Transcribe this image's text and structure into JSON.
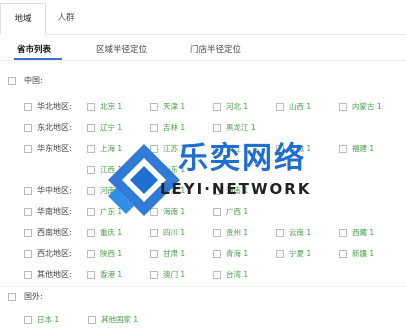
{
  "tabs": [
    {
      "label": "地域",
      "active": true
    },
    {
      "label": "人群",
      "active": false
    }
  ],
  "sub_tabs": [
    {
      "label": "省市列表",
      "active": true
    },
    {
      "label": "区域半径定位",
      "active": false
    },
    {
      "label": "门店半径定位",
      "active": false
    }
  ],
  "china": {
    "label": "中国:",
    "regions": [
      {
        "label": "华北地区:",
        "cities": [
          "北京 1",
          "天津 1",
          "河北 1",
          "山西 1",
          "内蒙古 1"
        ]
      },
      {
        "label": "东北地区:",
        "cities": [
          "辽宁 1",
          "吉林 1",
          "黑龙江 1"
        ]
      },
      {
        "label": "华东地区:",
        "cities": [
          "上海 1",
          "江苏 1",
          "浙江 1",
          "安徽 1",
          "福建 1",
          "江西 1",
          "山东 1"
        ]
      },
      {
        "label": "华中地区:",
        "cities": [
          "河南 1",
          "湖北 1",
          "湖南 1"
        ]
      },
      {
        "label": "华南地区:",
        "cities": [
          "广东 1",
          "海南 1",
          "广西 1"
        ]
      },
      {
        "label": "西南地区:",
        "cities": [
          "重庆 1",
          "四川 1",
          "贵州 1",
          "云南 1",
          "西藏 1"
        ]
      },
      {
        "label": "西北地区:",
        "cities": [
          "陕西 1",
          "甘肃 1",
          "青海 1",
          "宁夏 1",
          "新疆 1"
        ]
      },
      {
        "label": "其他地区:",
        "cities": [
          "香港 1",
          "澳门 1",
          "台湾 1"
        ]
      }
    ]
  },
  "abroad": {
    "label": "国外:",
    "items": [
      "日本 1",
      "其他国家 1"
    ]
  },
  "watermark": {
    "title": "乐奕网络",
    "subtitle": "LEYI·NETWORK",
    "color": "#1f6fd1"
  }
}
